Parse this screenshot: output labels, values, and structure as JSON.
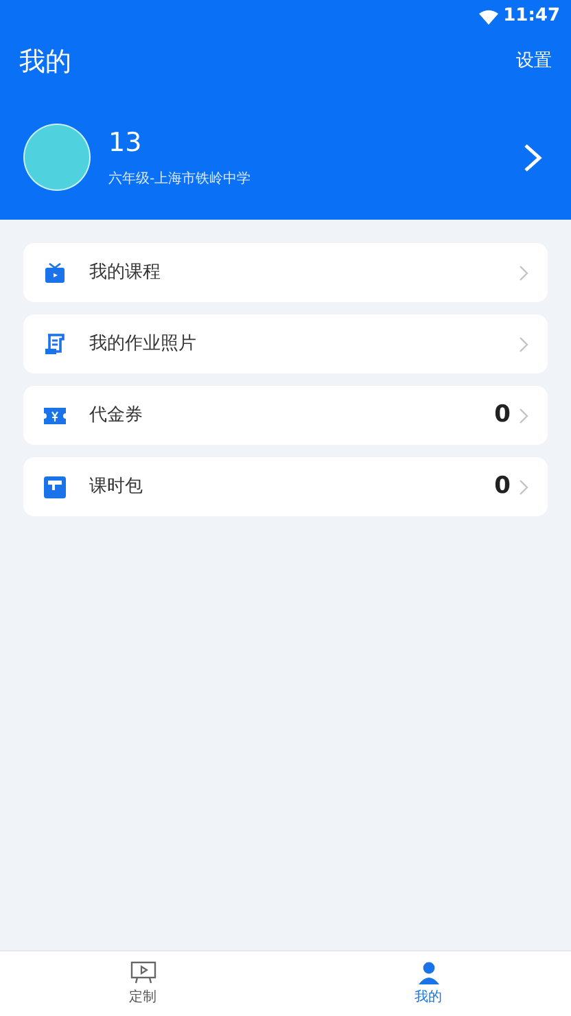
{
  "status_bar": {
    "time": "11:47"
  },
  "header": {
    "title": "我的",
    "settings": "设置"
  },
  "profile": {
    "name": "13",
    "school": "六年级-上海市铁岭中学"
  },
  "menu": [
    {
      "label": "我的课程"
    },
    {
      "label": "我的作业照片"
    },
    {
      "label": "代金券",
      "value": "0"
    },
    {
      "label": "课时包",
      "value": "0"
    }
  ],
  "tab_bar": [
    {
      "label": "定制",
      "selected": false
    },
    {
      "label": "我的",
      "selected": true
    }
  ]
}
